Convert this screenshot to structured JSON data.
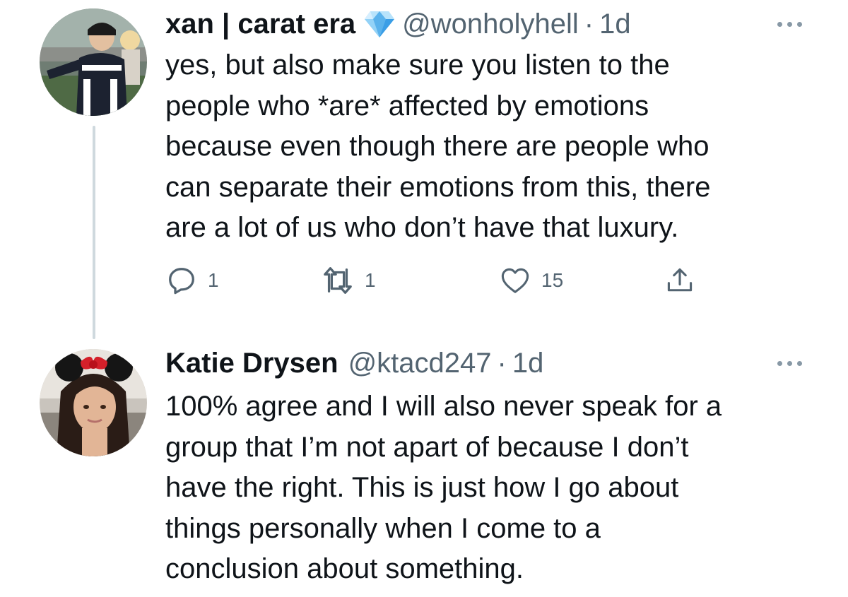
{
  "tweets": [
    {
      "display_name": "xan | carat era",
      "name_emoji": "gem-stone",
      "handle": "@wonholyhell",
      "separator": "·",
      "time": "1d",
      "lines": [
        "yes, but also make sure you listen to the",
        "people who *are* affected by emotions",
        "because even though there are people who",
        "can separate their emotions from this, there",
        "are a lot of us who don’t have that luxury."
      ],
      "actions": {
        "replies": "1",
        "retweets": "1",
        "likes": "15"
      },
      "icons": [
        "reply-icon",
        "retweet-icon",
        "like-icon",
        "share-icon",
        "more-icon"
      ]
    },
    {
      "display_name": "Katie Drysen",
      "handle": "@ktacd247",
      "separator": "·",
      "time": "1d",
      "lines": [
        "100% agree and I will also never speak for a",
        "group that I’m not apart of because I don’t",
        "have the right. This is just how I go about",
        "things personally when I come to a",
        "conclusion about something."
      ],
      "icons": [
        "more-icon"
      ]
    }
  ],
  "colors": {
    "text": "#0f1419",
    "secondary": "#536471",
    "thread_line": "#cfd9de",
    "icon": "#536471"
  }
}
